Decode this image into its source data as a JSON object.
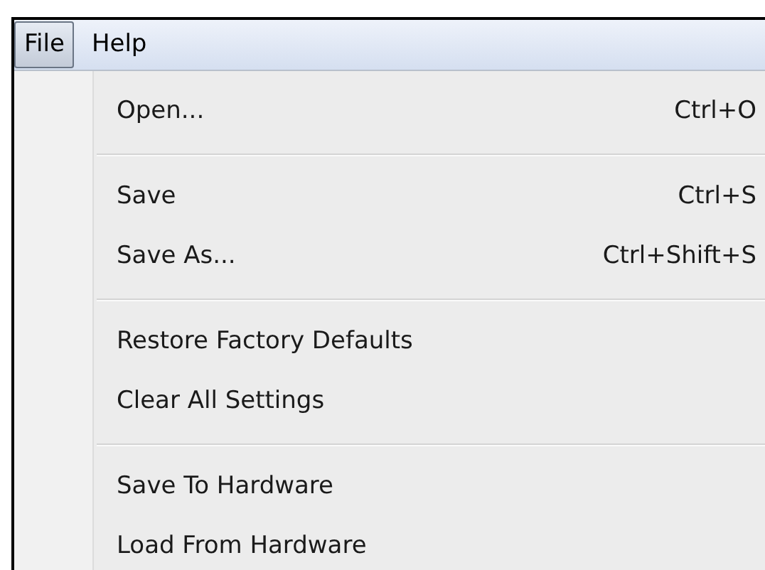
{
  "menubar": [
    {
      "label": "File",
      "selected": true
    },
    {
      "label": "Help",
      "selected": false
    }
  ],
  "menu": {
    "groups": [
      [
        {
          "label": "Open...",
          "shortcut": "Ctrl+O"
        }
      ],
      [
        {
          "label": "Save",
          "shortcut": "Ctrl+S"
        },
        {
          "label": "Save As...",
          "shortcut": "Ctrl+Shift+S"
        }
      ],
      [
        {
          "label": "Restore Factory Defaults"
        },
        {
          "label": "Clear All Settings"
        }
      ],
      [
        {
          "label": "Save To Hardware"
        },
        {
          "label": "Load From Hardware"
        }
      ]
    ]
  }
}
